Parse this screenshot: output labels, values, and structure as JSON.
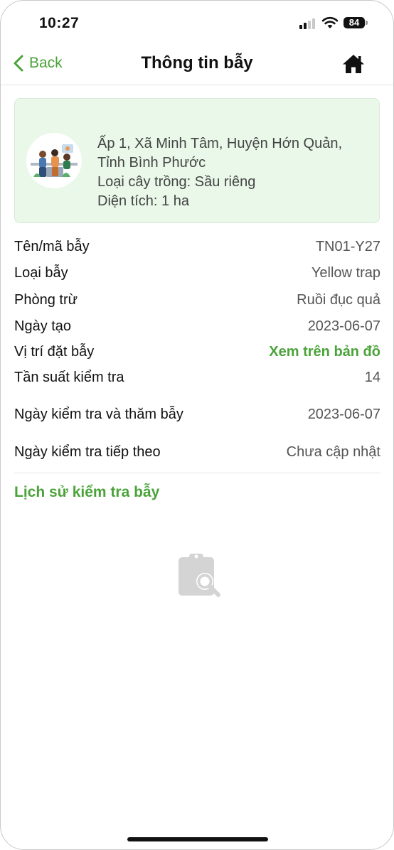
{
  "status_bar": {
    "time": "10:27",
    "battery": "84"
  },
  "nav": {
    "back_label": "Back",
    "title": "Thông tin bẫy"
  },
  "card": {
    "address_line1": "Ấp 1, Xã Minh Tâm, Huyện Hớn Quản,",
    "address_line2": "Tỉnh Bình Phước",
    "crop": "Loại cây trồng: Sầu riêng",
    "area": "Diện tích: 1 ha"
  },
  "details": [
    {
      "label": "Tên/mã bẫy",
      "value": "TN01-Y27"
    },
    {
      "label": "Loại bẫy",
      "value": "Yellow trap"
    },
    {
      "label": "Phòng trừ",
      "value": "Ruồi đục quả"
    },
    {
      "label": "Ngày tạo",
      "value": "2023-06-07"
    },
    {
      "label": "Vị trí đặt bẫy",
      "value": "Xem trên bản đồ"
    },
    {
      "label": "Tần suất kiểm tra",
      "value": "14"
    },
    {
      "label": "Ngày kiểm tra và thăm bẫy",
      "value": "2023-06-07"
    },
    {
      "label": "Ngày kiểm tra tiếp theo",
      "value": "Chưa cập nhật"
    }
  ],
  "history": {
    "title": "Lịch sử kiểm tra bẫy"
  },
  "colors": {
    "accent": "#4aa339",
    "card_bg": "#e9f8e9",
    "icon_gray": "#d4d4d4"
  },
  "icons": {
    "back": "chevron-left-icon",
    "home": "home-icon",
    "empty": "clipboard-search-icon"
  }
}
